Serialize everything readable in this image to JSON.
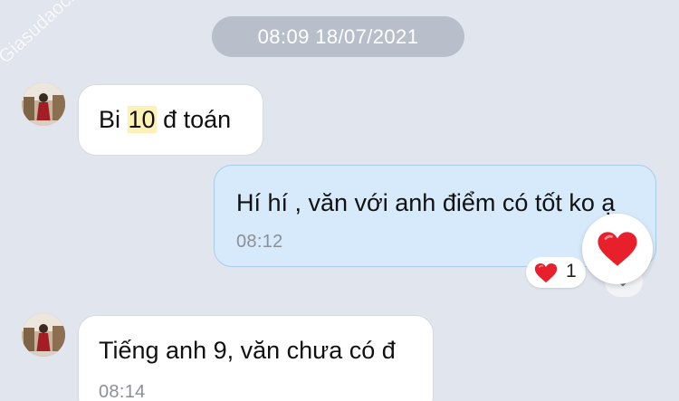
{
  "date_separator": "08:09 18/07/2021",
  "watermark": "Giasudaochau.net",
  "messages": [
    {
      "direction": "incoming",
      "text_before": "Bi ",
      "text_highlight": "10",
      "text_after": " đ toán"
    },
    {
      "direction": "outgoing",
      "text": "Hí hí , văn với anh điểm có tốt ko ạ",
      "time": "08:12",
      "reaction": {
        "icon": "heart-icon",
        "emoji": "❤",
        "count": "1"
      }
    },
    {
      "direction": "incoming",
      "text": "Tiếng anh 9, văn chưa có đ",
      "time": "08:14"
    }
  ],
  "colors": {
    "background": "#e1e5ee",
    "incoming_bubble": "#ffffff",
    "outgoing_bubble": "#d7eafb",
    "outgoing_border": "#a8cdea",
    "date_pill": "#b8bfca",
    "highlight": "#fdf1b8",
    "heart": "#e8202c"
  }
}
